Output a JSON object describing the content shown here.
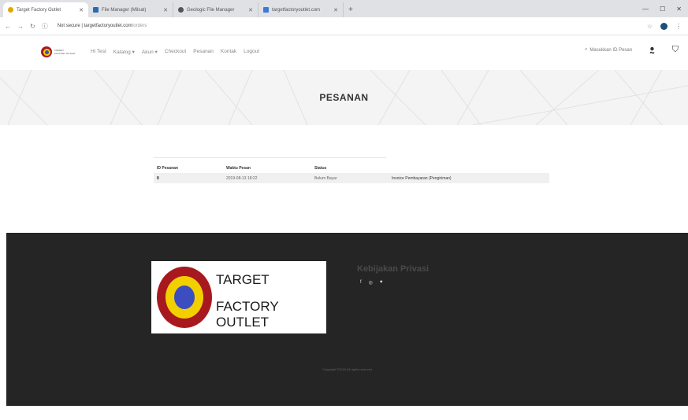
{
  "browser": {
    "tabs": [
      {
        "label": "Target Factory Outlet",
        "active": true
      },
      {
        "label": "File Manager (Milsat)",
        "active": false
      },
      {
        "label": "Geologic File Manager",
        "active": false
      },
      {
        "label": "targetfactoryoutlet.com",
        "active": false
      }
    ],
    "new_tab": "+",
    "url_host": "Not secure | targetfactoryoutlet.com",
    "url_path": "/orders"
  },
  "header": {
    "logo_text_1": "TARGET",
    "logo_text_2": "FACTORY OUTLET",
    "nav": [
      "Hi Test",
      "Katalog",
      "Akun",
      "Checkout",
      "Pesanan",
      "Kontak",
      "Logout"
    ],
    "search_placeholder": "Masukkan ID Pesan"
  },
  "hero": {
    "title": "PESANAN"
  },
  "orders": {
    "columns": [
      "ID Pesanan",
      "Waktu Pesan",
      "Status",
      ""
    ],
    "rows": [
      {
        "id": "8",
        "time": "2019-08-13 18:22",
        "status": "Belum Bayar",
        "action": "Invoice Pembayaran (Pengiriman)"
      }
    ]
  },
  "footer": {
    "brand_line1": "TARGET",
    "brand_line2": "FACTORY OUTLET",
    "privacy": "Kebijakan Privasi",
    "social": [
      "f",
      "◎",
      "♥"
    ],
    "copyright": "Copyright ©2019 All rights reserved"
  },
  "colors": {
    "footer_bg": "#252525",
    "ring_outer": "#a8191f",
    "ring_mid": "#f2d000",
    "ring_inner": "#3b4dbf"
  }
}
